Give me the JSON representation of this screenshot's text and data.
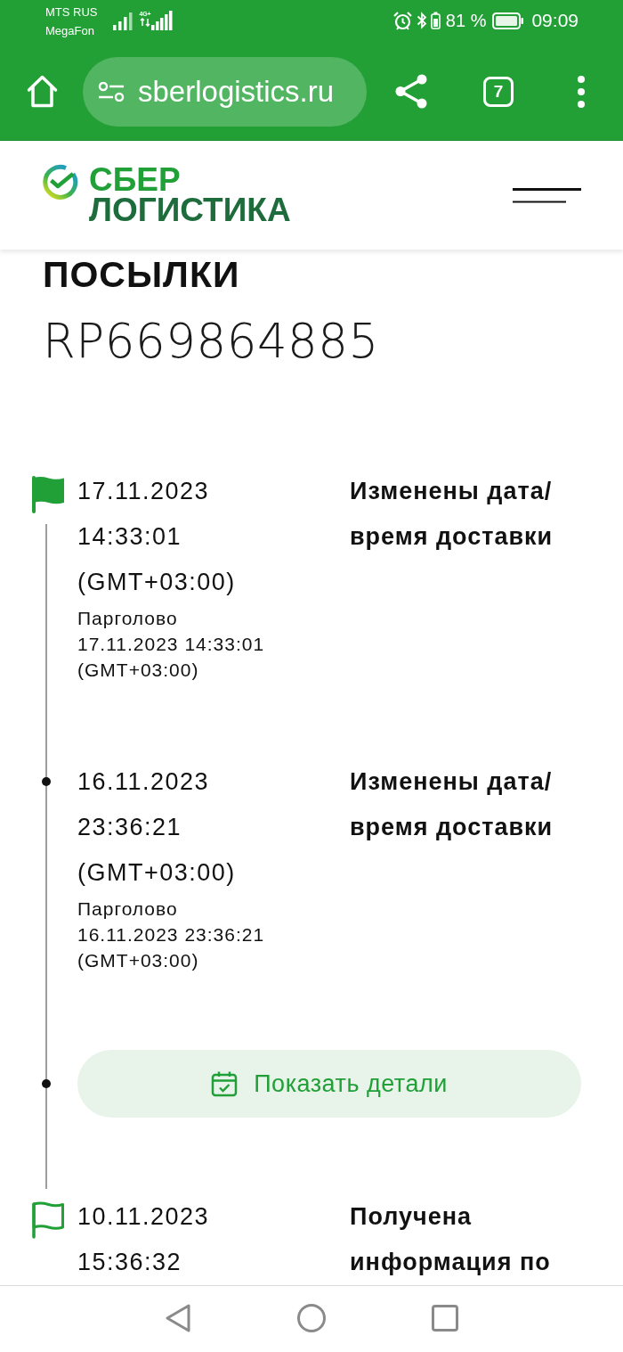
{
  "status_bar": {
    "carrier_1": "MTS RUS",
    "carrier_2": "MegaFon",
    "network_type": "4G+",
    "battery": "81 %",
    "time": "09:09"
  },
  "browser_toolbar": {
    "url": "sberlogistics.ru",
    "tab_count": "7"
  },
  "site_header": {
    "logo_line_1": "СБЕР",
    "logo_line_2": "ЛОГИСТИКА"
  },
  "tracking": {
    "heading": "ПОСЫЛКИ",
    "number": "RP669864885",
    "timeline": [
      {
        "kind": "flag",
        "filled": true,
        "date": "17.11.2023",
        "time": "14:33:01",
        "timezone": "(GMT+03:00)",
        "location": "Парголово",
        "location_time": "17.11.2023 14:33:01 (GMT+03:00)",
        "status": "Изменены дата/ время доставки"
      },
      {
        "kind": "dot",
        "date": "16.11.2023",
        "time": "23:36:21",
        "timezone": "(GMT+03:00)",
        "location": "Парголово",
        "location_time": "16.11.2023 23:36:21 (GMT+03:00)",
        "status": "Изменены дата/ время доставки"
      },
      {
        "kind": "button",
        "label": "Показать детали"
      },
      {
        "kind": "flag",
        "filled": false,
        "date": "10.11.2023",
        "time": "15:36:32",
        "status": "Получена информация по"
      }
    ]
  }
}
